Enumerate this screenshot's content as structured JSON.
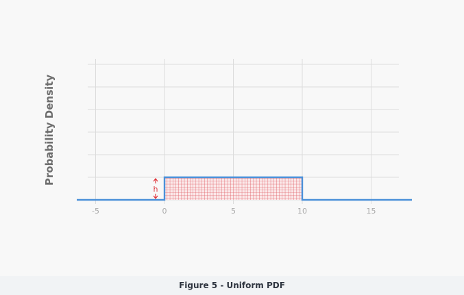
{
  "caption": "Figure 5 - Uniform PDF",
  "chart_data": {
    "type": "line",
    "title": "",
    "xlabel": "",
    "ylabel": "Probability Density",
    "xlim": [
      -6.5,
      18
    ],
    "ylim": [
      0,
      0.6
    ],
    "xticks": [
      -5,
      0,
      5,
      10,
      15
    ],
    "grid": true,
    "series": [
      {
        "x": [
          -6.5,
          0,
          0,
          10,
          10,
          18
        ],
        "y": [
          0,
          0,
          0.1,
          0.1,
          0,
          0
        ],
        "color": "#4a90d9"
      }
    ],
    "shaded_region": {
      "x_start": 0,
      "x_end": 10,
      "height": 0.1,
      "color": "#e0333a",
      "pattern": "grid"
    },
    "annotation": {
      "text": "h",
      "x": -0.5,
      "color": "#e0333a"
    }
  }
}
